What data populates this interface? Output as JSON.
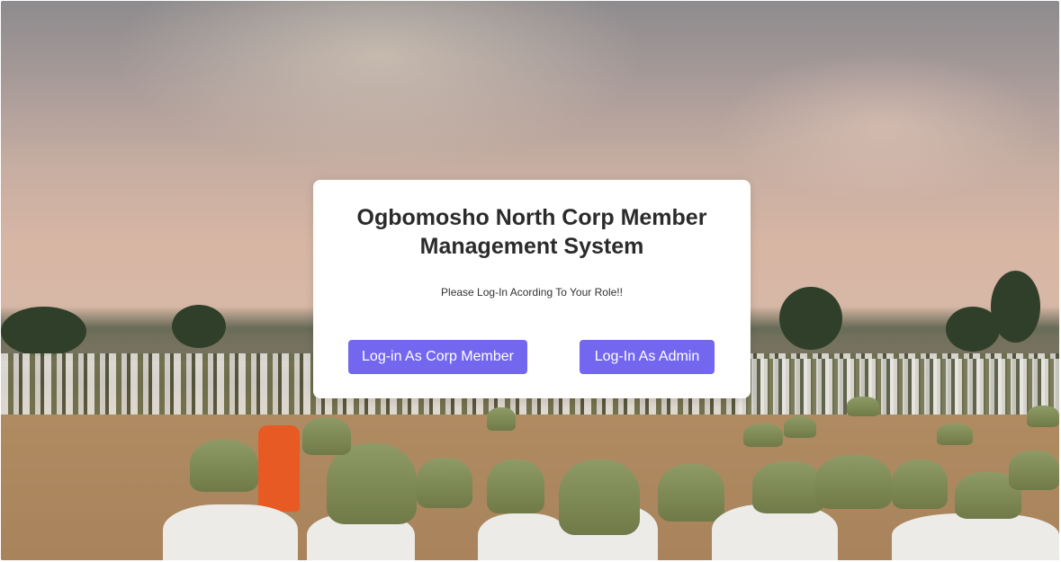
{
  "background": {
    "description_icon": "nysc-parade-photo"
  },
  "card": {
    "title": "Ogbomosho North Corp Member Management System",
    "subtitle": "Please Log-In Acording To Your Role!!",
    "buttons": {
      "corp_member": "Log-in As Corp Member",
      "admin": "Log-In As Admin"
    }
  },
  "colors": {
    "button_bg": "#7367f0",
    "button_text": "#ffffff",
    "card_bg": "#ffffff",
    "title_text": "#2b2b2b"
  }
}
